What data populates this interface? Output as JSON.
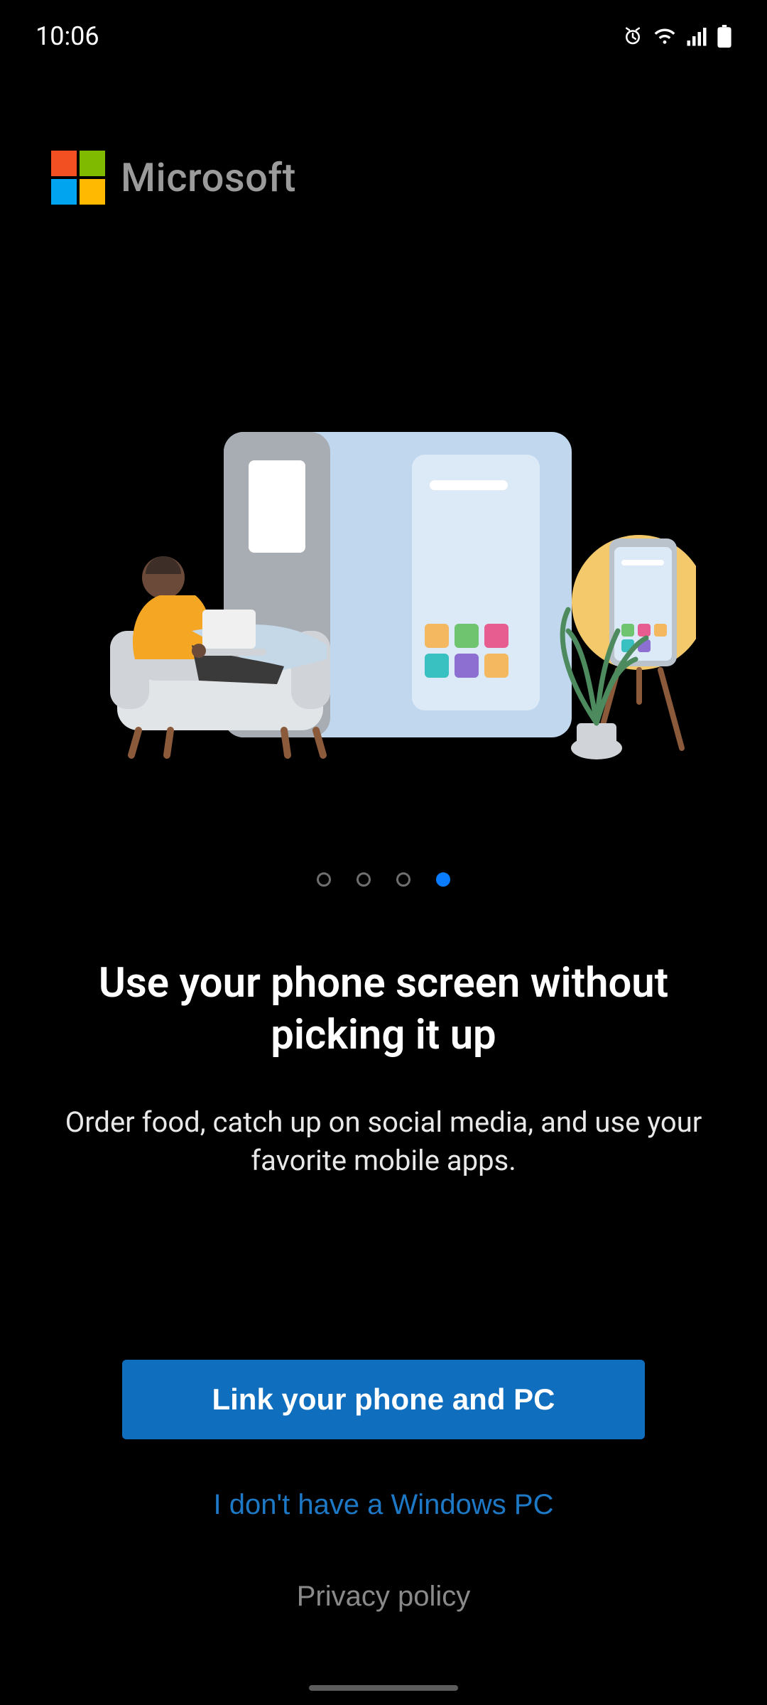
{
  "status": {
    "time": "10:06"
  },
  "brand": {
    "name": "Microsoft"
  },
  "pager": {
    "total": 4,
    "active_index": 3
  },
  "content": {
    "headline": "Use your phone screen without picking it up",
    "subtext": "Order food, catch up on social media, and use your favorite mobile apps."
  },
  "actions": {
    "primary": "Link your phone and PC",
    "secondary": "I don't have a Windows PC",
    "privacy": "Privacy policy"
  }
}
